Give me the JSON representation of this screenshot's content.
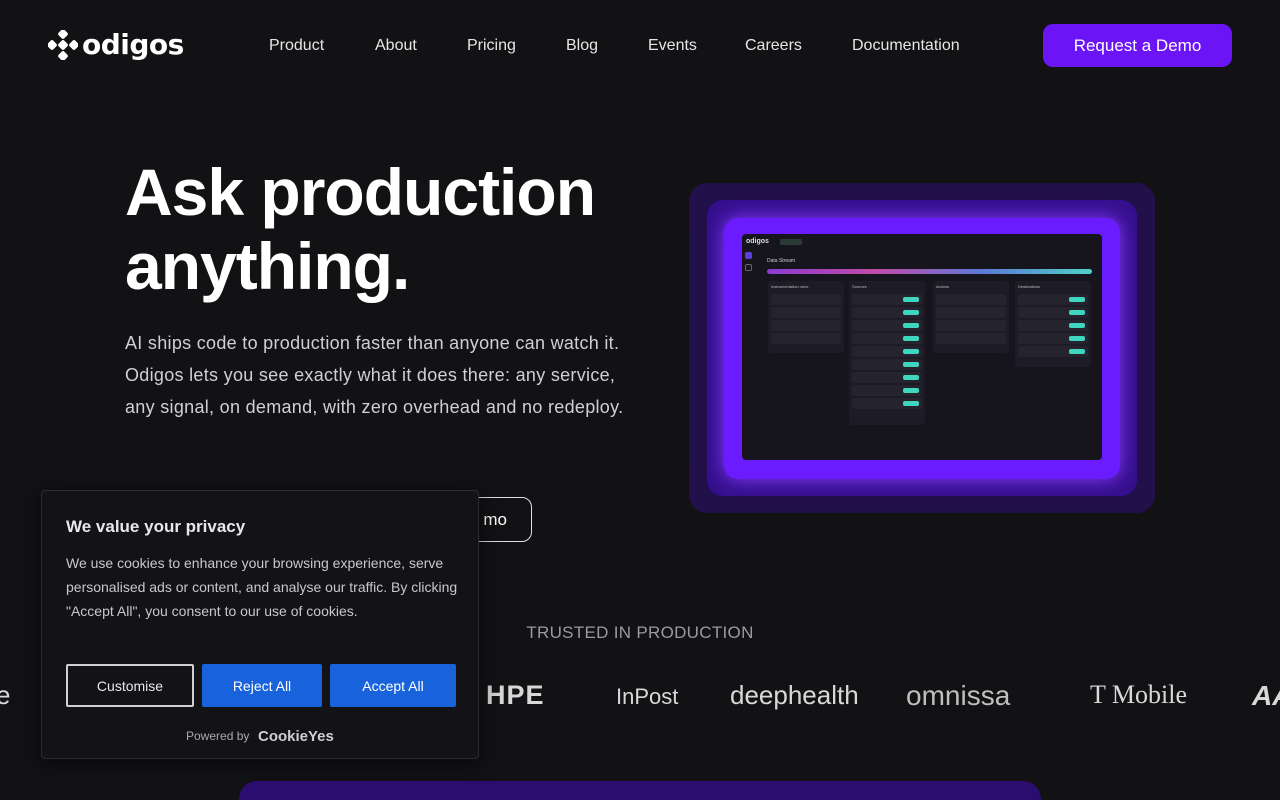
{
  "nav": {
    "logo_text": "odigos",
    "links": [
      "Product",
      "About",
      "Pricing",
      "Blog",
      "Events",
      "Careers",
      "Documentation"
    ],
    "cta": "Request a Demo"
  },
  "hero": {
    "title_line1": "Ask production",
    "title_line2": "anything.",
    "subtitle": "AI ships code to production faster than anyone can watch it. Odigos lets you see exactly what it does there: any service, any signal, on demand, with zero overhead and no redeploy.",
    "secondary_button": "mo"
  },
  "preview": {
    "logo": "odigos",
    "title": "Data Stream",
    "columns": [
      {
        "title": "Instrumentation rules"
      },
      {
        "title": "Sources"
      },
      {
        "title": "Actions"
      },
      {
        "title": "Destinations"
      }
    ]
  },
  "cookie": {
    "title": "We value your privacy",
    "text": "We use cookies to enhance your browsing experience, serve personalised ads or content, and analyse our traffic. By clicking \"Accept All\", you consent to our use of cookies.",
    "customise": "Customise",
    "reject": "Reject All",
    "accept": "Accept All",
    "powered_by": "Powered by",
    "brand": "CookieYes"
  },
  "trusted": {
    "heading": "TRUSTED IN PRODUCTION",
    "logos": [
      "e",
      "HPE",
      "InPost",
      "deephealth",
      "omnissa",
      "T Mobile",
      "AA"
    ]
  },
  "colors": {
    "accent": "#6b14f5",
    "cookie_button": "#1863dc",
    "background": "#121114"
  }
}
